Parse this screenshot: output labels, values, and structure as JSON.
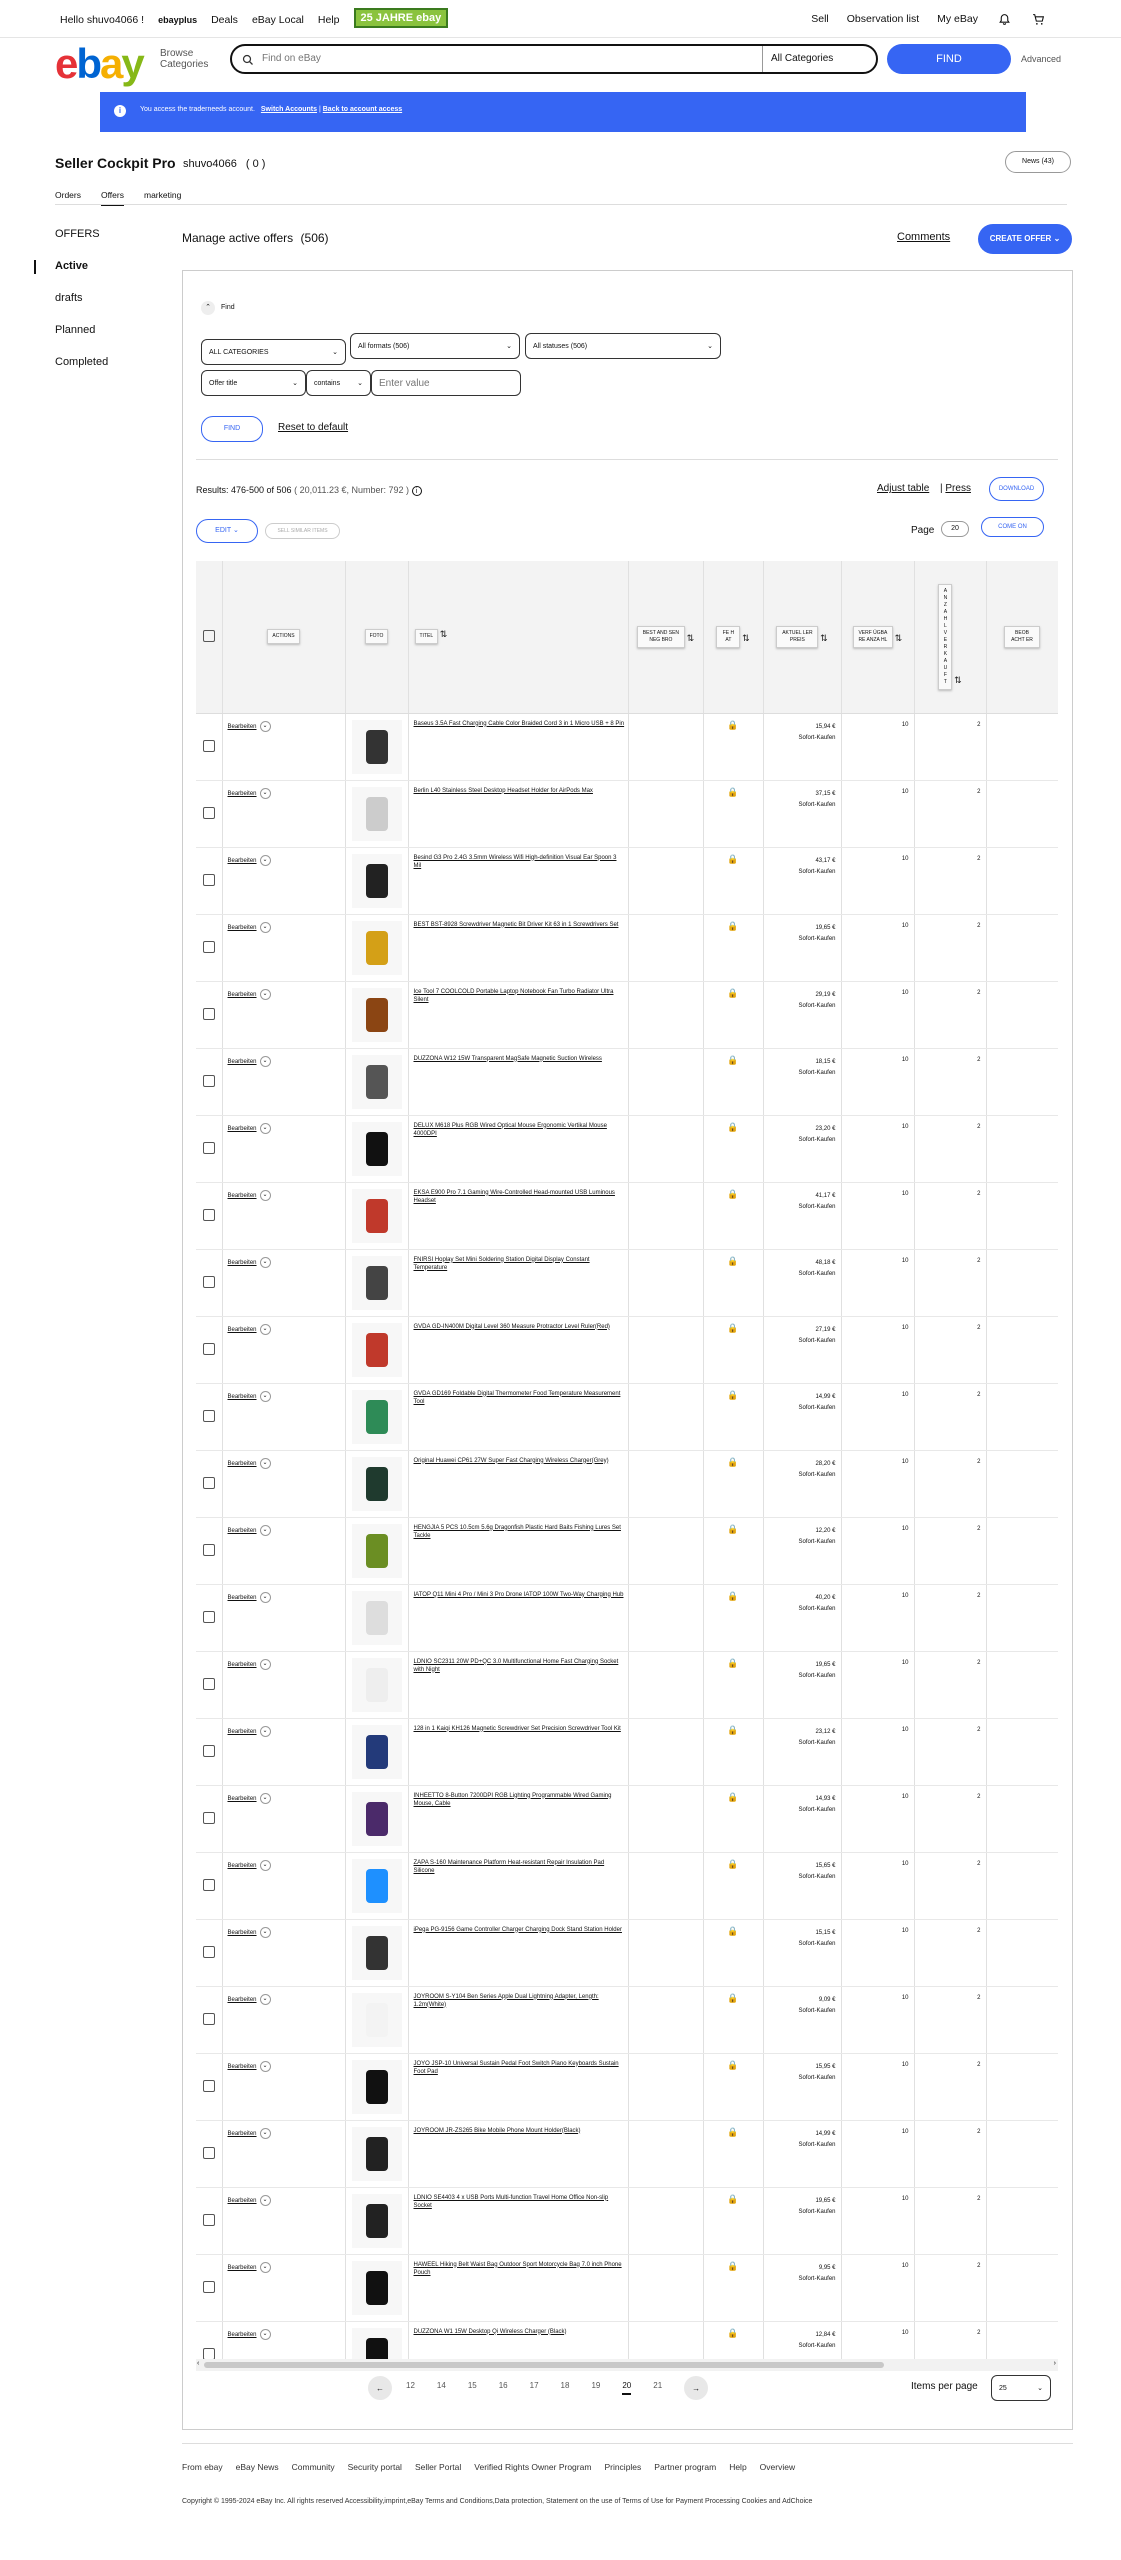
{
  "topbar": {
    "greeting": "Hello shuvo4066 !",
    "ebay_plus": "ebayplus",
    "deals": "Deals",
    "local": "eBay Local",
    "help": "Help",
    "anniversary": "25 JAHRE ebay",
    "sell": "Sell",
    "watchlist": "Observation list",
    "my_ebay": "My eBay"
  },
  "header": {
    "logo_e": "e",
    "logo_b": "b",
    "logo_a": "a",
    "logo_y": "y",
    "browse": "Browse Categories",
    "search_placeholder": "Find on eBay",
    "category": "All Categories",
    "find": "FIND",
    "advanced": "Advanced"
  },
  "banner": {
    "text": "You access the traderneeds account.",
    "link1": "Switch Accounts",
    "link2": "Back to account access"
  },
  "page": {
    "title": "Seller Cockpit Pro",
    "user": "shuvo4066",
    "score": "( 0 )",
    "news": "News (43)"
  },
  "tabs": [
    "Orders",
    "Offers",
    "marketing"
  ],
  "sidebar": {
    "heading": "OFFERS",
    "items": [
      "Active",
      "drafts",
      "Planned",
      "Completed"
    ]
  },
  "main": {
    "title": "Manage active offers",
    "count": "(506)",
    "comments": "Comments",
    "create": "CREATE OFFER"
  },
  "filters": {
    "find_label": "Find",
    "categories": "ALL CATEGORIES",
    "formats": "All formats (506)",
    "statuses": "All statuses (506)",
    "field": "Offer title",
    "operator": "contains",
    "value_placeholder": "Enter value",
    "find_btn": "FIND",
    "reset": "Reset to default"
  },
  "results": {
    "text": "Results: 476-500 of 506",
    "summary": "( 20,011.23 €, Number: 792 )",
    "adjust": "Adjust table",
    "press": "Press",
    "download": "DOWNLOAD",
    "edit": "EDIT",
    "sell_similar": "SELL SIMILAR ITEMS",
    "page_label": "Page",
    "page_value": "20",
    "come_on": "COME ON"
  },
  "table": {
    "headers": {
      "actions": "ACTIONS",
      "photo": "FOTO",
      "title": "TITEL",
      "best_offer": "BEST AND SEN NEG BRO",
      "qty": "FE H AT",
      "price": "AKTUEL LER PREIS",
      "avail": "VERF ÜGBA RE ANZA HL",
      "sold": "A N Z A H L V E R K A U F T",
      "watchers": "BEOB ACHT ER"
    },
    "rows": [
      {
        "title": "Baseus 3.5A Fast Charging Cable Color Braided Cord 3 in 1 Micro USB + 8 Pin",
        "price": "15,94 €",
        "avail": "10",
        "sold": "2"
      },
      {
        "title": "Berlin L40 Stainless Steel Desktop Headset Holder for AirPods Max",
        "price": "37,15 €",
        "avail": "10",
        "sold": "2"
      },
      {
        "title": "Besind G3 Pro 2.4G 3.5mm Wireless Wifi High-definition Visual Ear Spoon 3 Mil",
        "price": "43,17 €",
        "avail": "10",
        "sold": "2"
      },
      {
        "title": "BEST BST-8928 Screwdriver Magnetic Bit Driver Kit 63 in 1 Screwdrivers Set",
        "price": "19,65 €",
        "avail": "10",
        "sold": "2"
      },
      {
        "title": "Ice Tool 7 COOLCOLD Portable Laptop Notebook Fan Turbo Radiator Ultra Silent",
        "price": "29,19 €",
        "avail": "10",
        "sold": "2"
      },
      {
        "title": "DUZZONA W12 15W Transparent MagSafe Magnetic Suction Wireless",
        "price": "18,15 €",
        "avail": "10",
        "sold": "2"
      },
      {
        "title": "DELUX M618 Plus RGB Wired Optical Mouse Ergonomic Vertikal Mouse 4000DPI",
        "price": "23,20 €",
        "avail": "10",
        "sold": "2"
      },
      {
        "title": "EKSA E900 Pro 7.1 Gaming Wire-Controlled Head-mounted USB Luminous Headset",
        "price": "41,17 €",
        "avail": "10",
        "sold": "2"
      },
      {
        "title": "FNIRSI Hoplay Set Mini Soldering Station Digital Display Constant Temperature",
        "price": "48,18 €",
        "avail": "10",
        "sold": "2"
      },
      {
        "title": "GVDA GD-IN400M Digital Level 360 Measure Protractor Level Ruler(Red)",
        "price": "27,19 €",
        "avail": "10",
        "sold": "2"
      },
      {
        "title": "GVDA GD169 Foldable Digital Thermometer Food Temperature Measurement Tool",
        "price": "14,99 €",
        "avail": "10",
        "sold": "2"
      },
      {
        "title": "Original Huawei CP61 27W Super Fast Charging Wireless Charger(Grey)",
        "price": "28,20 €",
        "avail": "10",
        "sold": "2"
      },
      {
        "title": "HENGJIA 5 PCS 10.5cm 5.6g Dragonfish Plastic Hard Baits Fishing Lures Set Tackle",
        "price": "12,20 €",
        "avail": "10",
        "sold": "2"
      },
      {
        "title": "IATOP Q11 Mini 4 Pro / Mini 3 Pro Drone IATOP 100W Two-Way Charging Hub",
        "price": "40,20 €",
        "avail": "10",
        "sold": "2"
      },
      {
        "title": "LDNIO SC2311 20W PD+QC 3.0 Multifunctional Home Fast Charging Socket with Night",
        "price": "19,65 €",
        "avail": "10",
        "sold": "2"
      },
      {
        "title": "128 in 1 Kaiqi KH126 Magnetic Screwdriver Set Precision Screwdriver Tool Kit",
        "price": "23,12 €",
        "avail": "10",
        "sold": "2"
      },
      {
        "title": "INHEETTO 8-Button 7200DPI RGB Lighting Programmable Wired Gaming Mouse, Cable",
        "price": "14,93 €",
        "avail": "10",
        "sold": "2"
      },
      {
        "title": "ZAPA S-160 Maintenance Platform Heat-resistant Repair Insulation Pad Silicone",
        "price": "15,65 €",
        "avail": "10",
        "sold": "2"
      },
      {
        "title": "iPega PG-9156 Game Controller Charger Charging Dock Stand Station Holder",
        "price": "15,15 €",
        "avail": "10",
        "sold": "2"
      },
      {
        "title": "JOYROOM S-Y104 Ben Series Apple Dual Lightning Adapter, Length: 1.2m(White)",
        "price": "9,09 €",
        "avail": "10",
        "sold": "2"
      },
      {
        "title": "JOYO JSP-10 Universal Sustain Pedal Foot Switch Piano Keyboards Sustain Foot Pad",
        "price": "15,95 €",
        "avail": "10",
        "sold": "2"
      },
      {
        "title": "JOYROOM JR-ZS265 Bike Mobile Phone Mount Holder(Black)",
        "price": "14,99 €",
        "avail": "10",
        "sold": "2"
      },
      {
        "title": "LDNIO SE4403 4 x USB Ports Multi-function Travel Home Office Non-slip Socket",
        "price": "19,65 €",
        "avail": "10",
        "sold": "2"
      },
      {
        "title": "HAWEEL Hiking Belt Waist Bag Outdoor Sport Motorcycle Bag 7.0 inch Phone Pouch",
        "price": "9,95 €",
        "avail": "10",
        "sold": "2"
      },
      {
        "title": "DUZZONA W1 15W Desktop Qi Wireless Charger (Black)",
        "price": "12,84 €",
        "avail": "10",
        "sold": "2"
      }
    ],
    "buy_now": "Sofort-Kaufen",
    "edit_link": "Bearbeiten"
  },
  "pagination": {
    "pages": [
      "12",
      "14",
      "15",
      "16",
      "17",
      "18",
      "19",
      "20",
      "21"
    ],
    "current": "20",
    "items_label": "Items per page",
    "items_value": "25"
  },
  "footer": {
    "links": [
      "From ebay",
      "eBay News",
      "Community",
      "Security portal",
      "Seller Portal",
      "Verified Rights Owner Program",
      "Principles",
      "Partner program",
      "Help",
      "Overview"
    ],
    "copyright": "Copyright © 1995-2024 eBay Inc. All rights reserved Accessibility,imprint,eBay Terms and Conditions,Data protection, Statement on the use of Terms of Use for Payment Processing Cookies and AdChoice"
  },
  "colors": {
    "accent": "#3665f3"
  }
}
